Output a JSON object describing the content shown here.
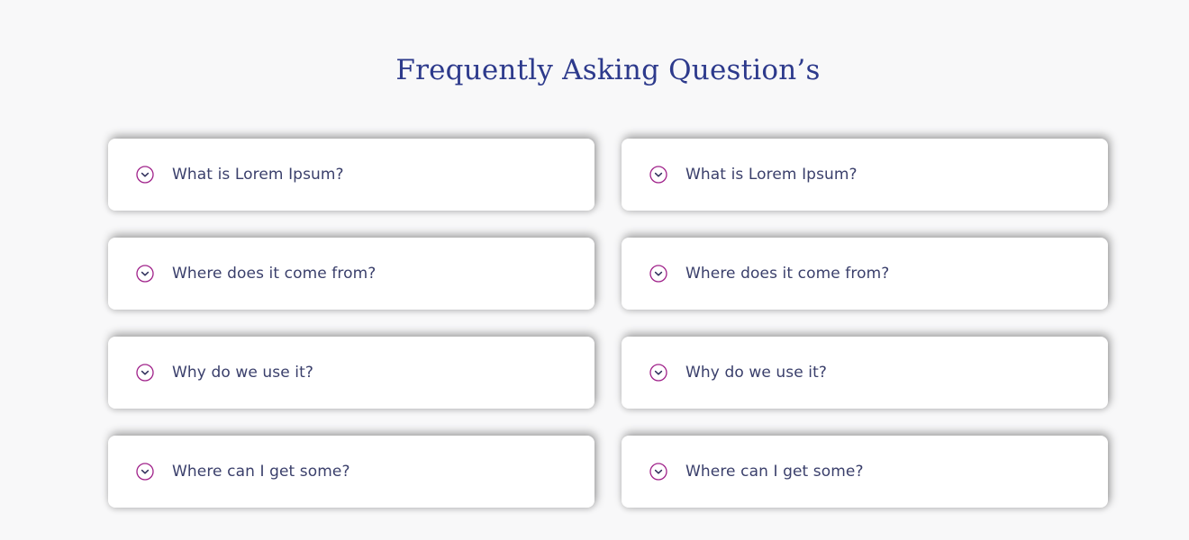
{
  "page": {
    "title": "Frequently Asking Question’s"
  },
  "colors": {
    "background": "#f8f8f9",
    "title": "#2d3a8c",
    "question_text": "#3a3f6b",
    "icon_accent": "#a0228a",
    "card": "#ffffff"
  },
  "faq": {
    "items": [
      {
        "question": "What is Lorem Ipsum?",
        "icon": "chevron-down-circle-icon",
        "expanded": false
      },
      {
        "question": "What is Lorem Ipsum?",
        "icon": "chevron-down-circle-icon",
        "expanded": false
      },
      {
        "question": "Where does it come from?",
        "icon": "chevron-down-circle-icon",
        "expanded": false
      },
      {
        "question": "Where does it come from?",
        "icon": "chevron-down-circle-icon",
        "expanded": false
      },
      {
        "question": "Why do we use it?",
        "icon": "chevron-down-circle-icon",
        "expanded": false
      },
      {
        "question": "Why do we use it?",
        "icon": "chevron-down-circle-icon",
        "expanded": false
      },
      {
        "question": "Where can I get some?",
        "icon": "chevron-down-circle-icon",
        "expanded": false
      },
      {
        "question": "Where can I get some?",
        "icon": "chevron-down-circle-icon",
        "expanded": false
      }
    ]
  }
}
